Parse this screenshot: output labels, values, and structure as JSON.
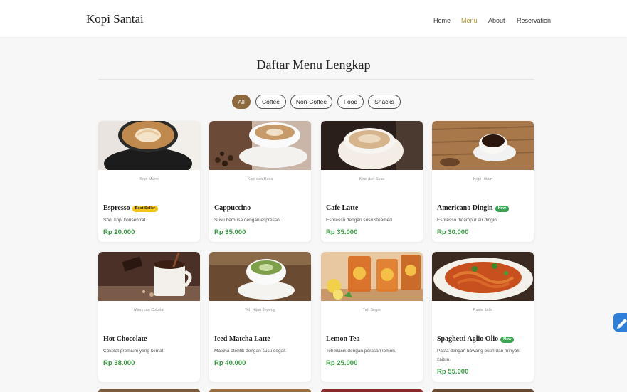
{
  "brand": "Kopi Santai",
  "nav": [
    "Home",
    "Menu",
    "About",
    "Reservation"
  ],
  "nav_active": "Menu",
  "section_title": "Daftar Menu Lengkap",
  "filters": [
    "All",
    "Coffee",
    "Non-Coffee",
    "Food",
    "Snacks"
  ],
  "filter_active": "All",
  "colors": {
    "accent": "#8c6a3e",
    "price": "#3a9a45",
    "nav_active": "#b6902f",
    "badge_best": "#f5c518",
    "badge_new": "#3aa655"
  },
  "items": [
    {
      "caption": "Kopi Murni",
      "name": "Espresso",
      "badge": "Best Seller",
      "desc": "Shot kopi konsentrat.",
      "price": "Rp 20.000"
    },
    {
      "caption": "Kopi dan Busa",
      "name": "Cappuccino",
      "badge": "",
      "desc": "Susu berbusa dengan espresso.",
      "price": "Rp 35.000"
    },
    {
      "caption": "Kopi dan Susu",
      "name": "Cafe Latte",
      "badge": "",
      "desc": "Espresso dengan susu steamed.",
      "price": "Rp 35.000"
    },
    {
      "caption": "Kopi Hitam",
      "name": "Americano Dingin",
      "badge": "New",
      "desc": "Espresso dicampur air dingin.",
      "price": "Rp 30.000"
    },
    {
      "caption": "Minuman Cokelat",
      "name": "Hot Chocolate",
      "badge": "",
      "desc": "Cokelat premium yang kental.",
      "price": "Rp 38.000"
    },
    {
      "caption": "Teh Hijau Jepang",
      "name": "Iced Matcha Latte",
      "badge": "",
      "desc": "Matcha otentik dengan susu segar.",
      "price": "Rp 40.000"
    },
    {
      "caption": "Teh Segar",
      "name": "Lemon Tea",
      "badge": "",
      "desc": "Teh klasik dengan perasan lemon.",
      "price": "Rp 25.000"
    },
    {
      "caption": "Pasta Italia",
      "name": "Spaghetti Aglio Olio",
      "badge": "New",
      "desc": "Pasta dengan bawang putih dan minyak zaitun.",
      "price": "Rp 55.000"
    }
  ]
}
